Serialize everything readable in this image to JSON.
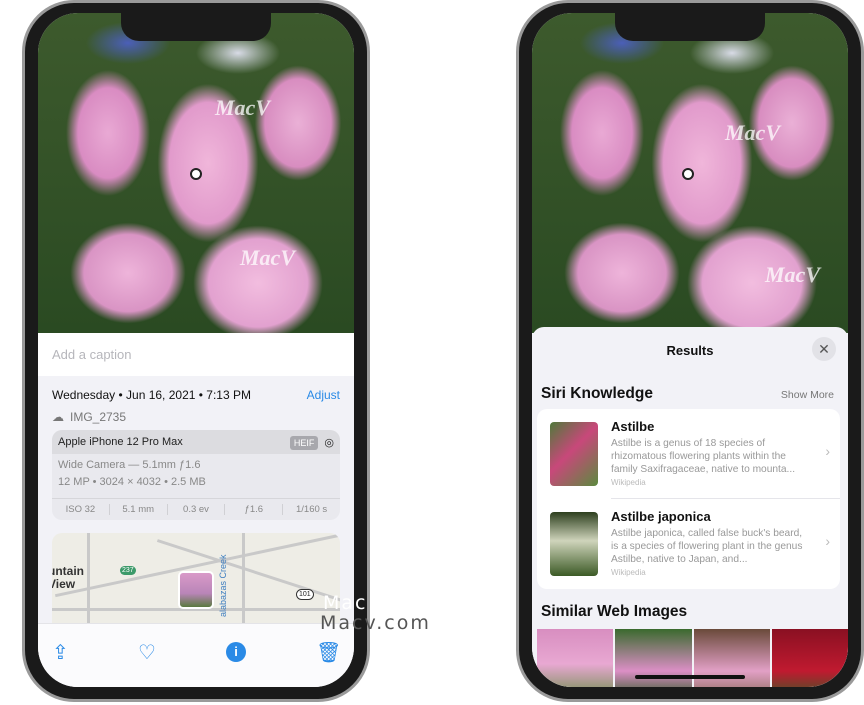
{
  "left_phone": {
    "caption_placeholder": "Add a caption",
    "date": "Wednesday • Jun 16, 2021 • 7:13 PM",
    "adjust_label": "Adjust",
    "filename": "IMG_2735",
    "camera": {
      "model": "Apple iPhone 12 Pro Max",
      "format": "HEIF",
      "lens": "Wide Camera — 5.1mm ƒ1.6",
      "specs": "12 MP • 3024 × 4032 • 2.5 MB",
      "exif": [
        "ISO 32",
        "5.1 mm",
        "0.3 ev",
        "ƒ1.6",
        "1/160 s"
      ]
    },
    "map": {
      "place": "untain\nView",
      "creek": "alabazas Creek",
      "routes": [
        "237",
        "101"
      ]
    },
    "toolbar": {
      "icons": [
        "share-icon",
        "heart-icon",
        "info-sparkle-icon",
        "trash-icon"
      ]
    }
  },
  "right_phone": {
    "sheet_title": "Results",
    "section_knowledge": "Siri Knowledge",
    "show_more": "Show More",
    "items": [
      {
        "name": "Astilbe",
        "desc": "Astilbe is a genus of 18 species of rhizomatous flowering plants within the family Saxifragaceae, native to mounta...",
        "source": "Wikipedia"
      },
      {
        "name": "Astilbe japonica",
        "desc": "Astilbe japonica, called false buck's beard, is a species of flowering plant in the genus Astilbe, native to Japan, and...",
        "source": "Wikipedia"
      }
    ],
    "section_images": "Similar Web Images"
  },
  "watermark": {
    "text": "Macv.com",
    "logo": "MacV.com"
  },
  "colors": {
    "accent": "#2a8ae6"
  }
}
